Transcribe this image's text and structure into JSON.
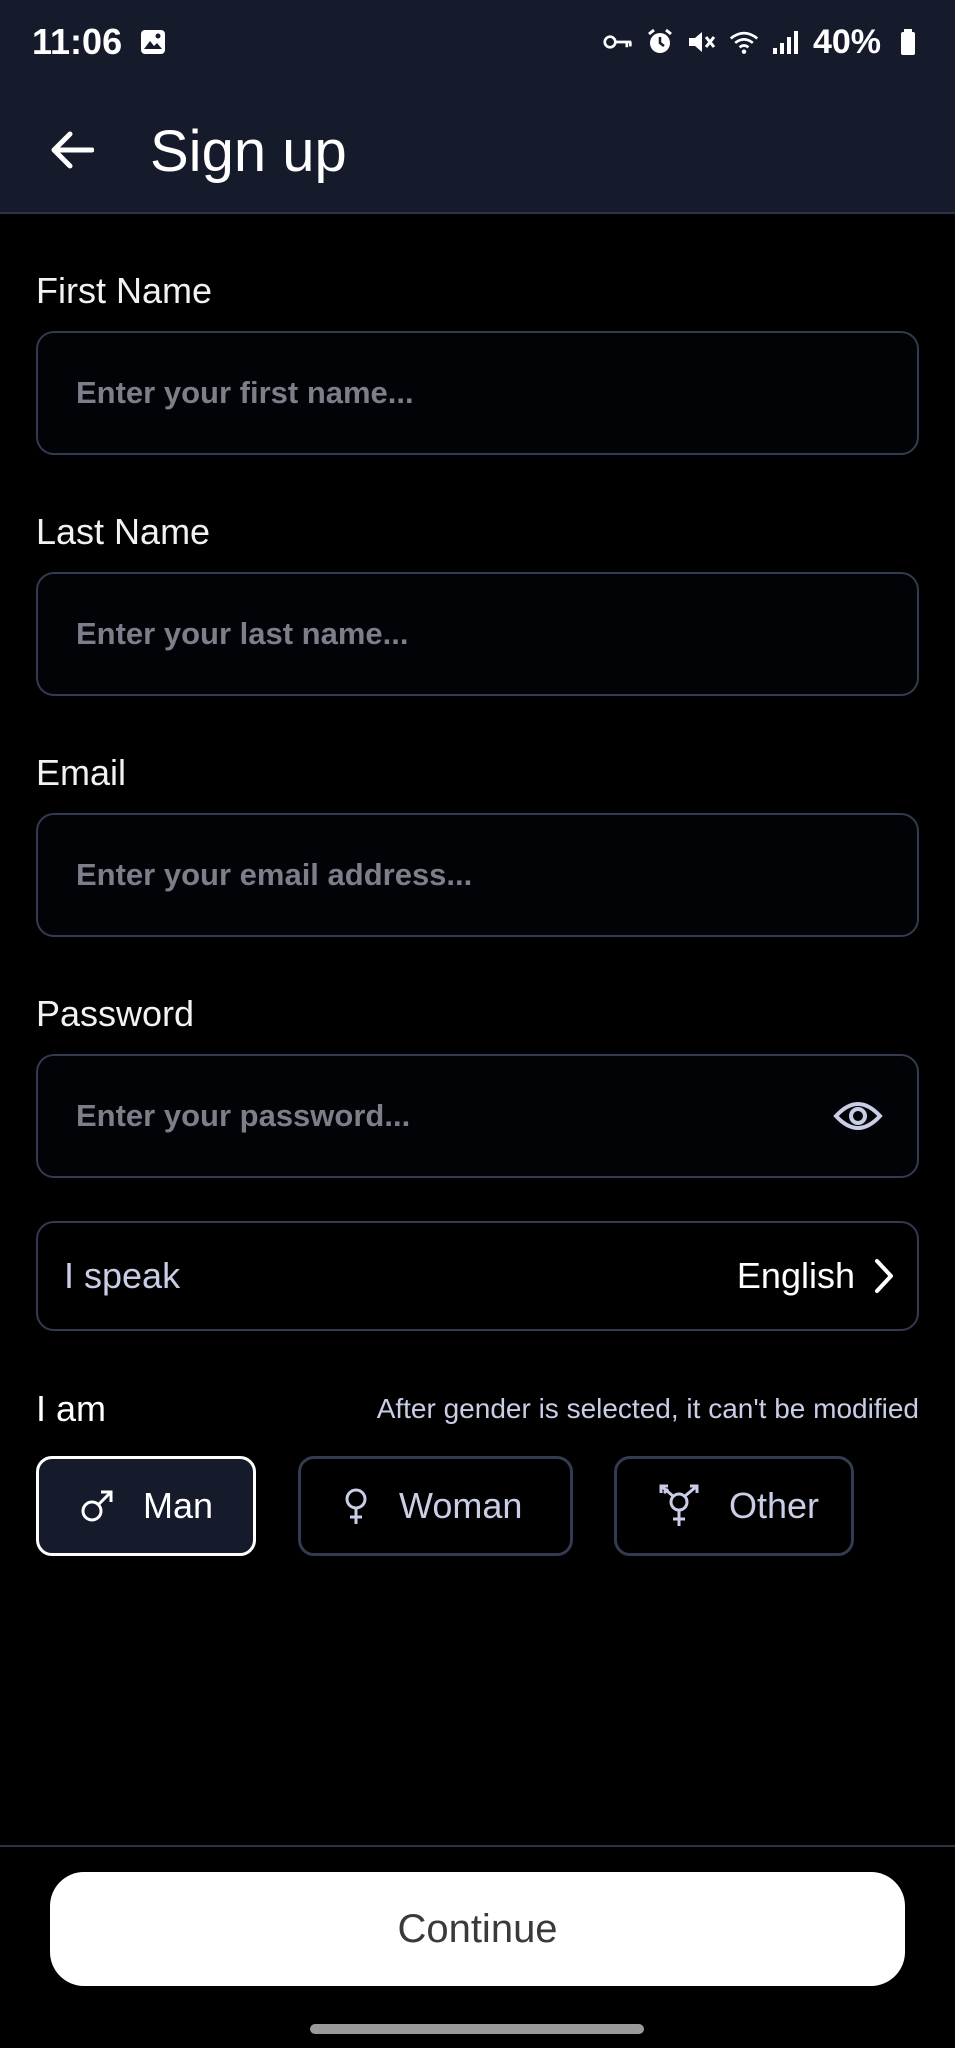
{
  "status_bar": {
    "time": "11:06",
    "battery": "40%"
  },
  "app_bar": {
    "title": "Sign up"
  },
  "form": {
    "first_name": {
      "label": "First Name",
      "placeholder": "Enter your first name...",
      "value": ""
    },
    "last_name": {
      "label": "Last Name",
      "placeholder": "Enter your last name...",
      "value": ""
    },
    "email": {
      "label": "Email",
      "placeholder": "Enter your email address...",
      "value": ""
    },
    "password": {
      "label": "Password",
      "placeholder": "Enter your password...",
      "value": ""
    },
    "language": {
      "label": "I speak",
      "value": "English"
    },
    "gender": {
      "label": "I am",
      "note": "After gender is selected, it can't be modified",
      "options": [
        {
          "label": "Man",
          "icon": "male-icon",
          "selected": true
        },
        {
          "label": "Woman",
          "icon": "female-icon",
          "selected": false
        },
        {
          "label": "Other",
          "icon": "transgender-icon",
          "selected": false
        }
      ]
    }
  },
  "footer": {
    "continue_label": "Continue"
  },
  "colors": {
    "background": "#000000",
    "bar_background": "#161b2b",
    "border": "#343a4f",
    "muted_text": "#c9cde6"
  }
}
